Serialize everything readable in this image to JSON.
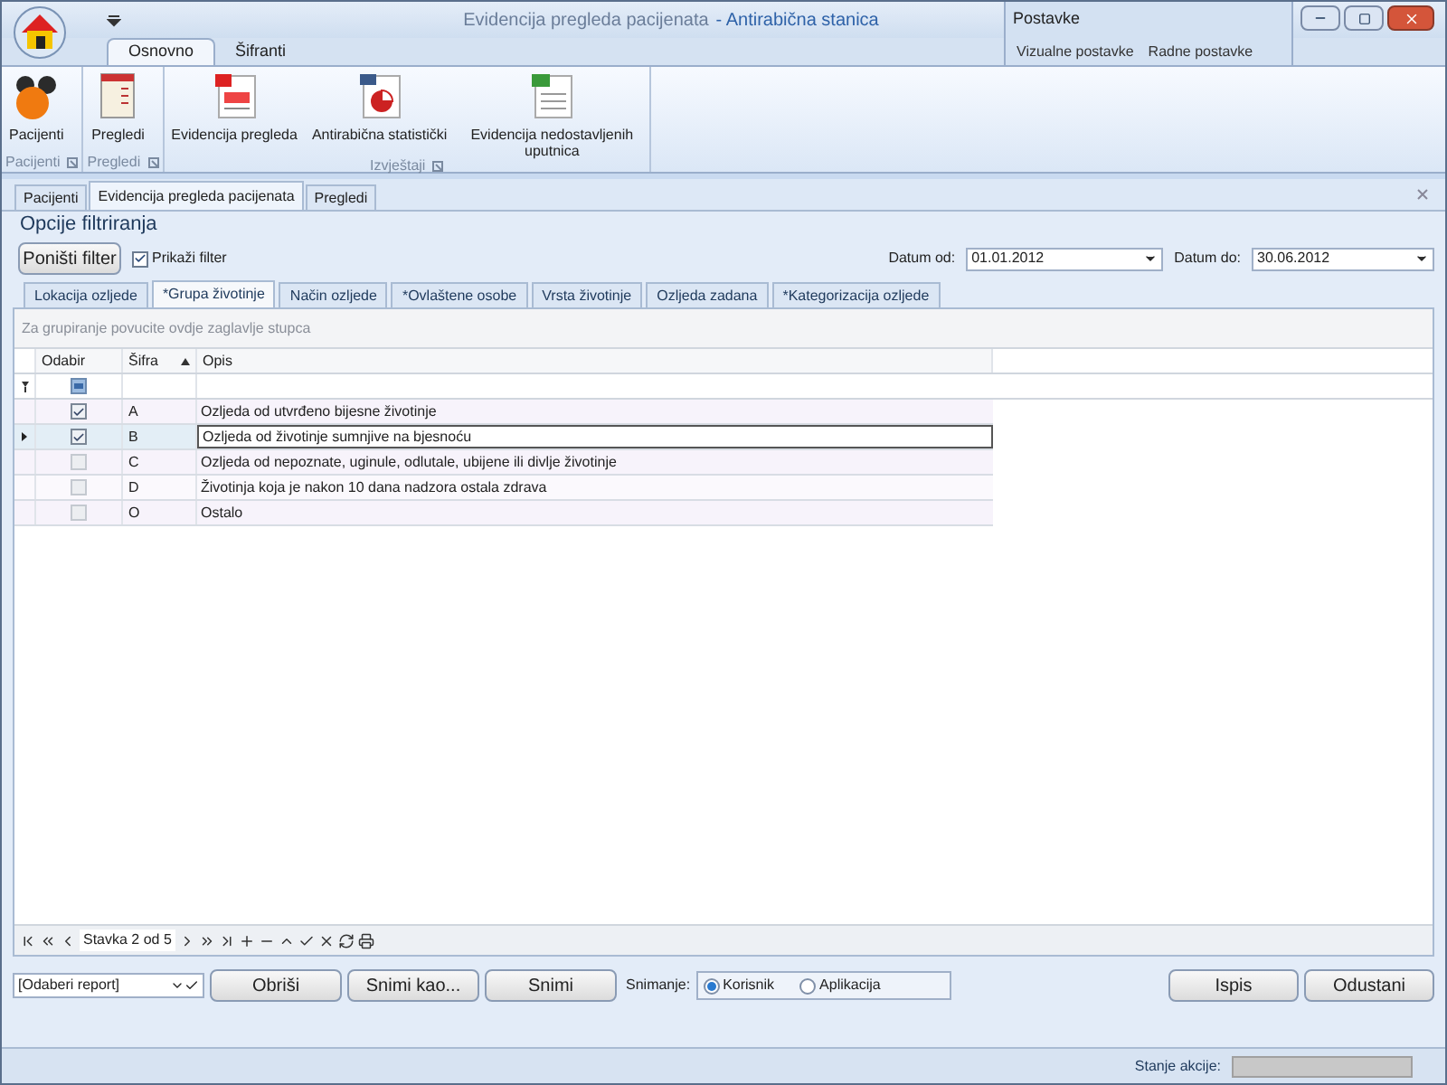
{
  "window": {
    "title": "Evidencija pregleda pacijenata",
    "subtitle": "- Antirabična stanica"
  },
  "context_group": {
    "title": "Postavke",
    "tabs": [
      {
        "label": "Vizualne postavke",
        "selected": false
      },
      {
        "label": "Radne postavke",
        "selected": false
      }
    ]
  },
  "ribbon_tabs": [
    {
      "label": "Osnovno",
      "selected": true
    },
    {
      "label": "Šifranti",
      "selected": false
    }
  ],
  "ribbon_groups": [
    {
      "title": "Pacijenti",
      "buttons": [
        {
          "label": "Pacijenti",
          "kind": "patients"
        }
      ]
    },
    {
      "title": "Pregledi",
      "buttons": [
        {
          "label": "Pregledi",
          "kind": "notebook"
        }
      ]
    },
    {
      "title": "Izvještaji",
      "buttons": [
        {
          "label": "Evidencija pregleda",
          "kind": "report"
        },
        {
          "label": "Antirabična statistički",
          "kind": "chart"
        },
        {
          "label": "Evidencija nedostavljenih uputnica",
          "kind": "sheet"
        }
      ]
    }
  ],
  "document_tabs": [
    {
      "label": "Pacijenti",
      "selected": false
    },
    {
      "label": "Evidencija pregleda pacijenata",
      "selected": true
    },
    {
      "label": "Pregledi",
      "selected": false
    }
  ],
  "filter_panel": {
    "title": "Opcije filtriranja",
    "reset_button": "Poništi filter",
    "show_filter": {
      "label": "Prikaži filter",
      "checked": true
    },
    "date_from": {
      "label": "Datum od:",
      "value": "01.01.2012"
    },
    "date_to": {
      "label": "Datum do:",
      "value": "30.06.2012"
    }
  },
  "category_tabs": [
    {
      "label": "Lokacija ozljede",
      "selected": false
    },
    {
      "label": "*Grupa životinje",
      "selected": true
    },
    {
      "label": "Način ozljede",
      "selected": false
    },
    {
      "label": "*Ovlaštene osobe",
      "selected": false
    },
    {
      "label": "Vrsta životinje",
      "selected": false
    },
    {
      "label": "Ozljeda zadana",
      "selected": false
    },
    {
      "label": "*Kategorizacija ozljede",
      "selected": false
    }
  ],
  "grid": {
    "group_panel_hint": "Za grupiranje povucite ovdje zaglavlje stupca",
    "columns": [
      {
        "label": "Odabir",
        "sorted_ascending": false
      },
      {
        "label": "Šifra",
        "sorted_ascending": true
      },
      {
        "label": "Opis",
        "sorted_ascending": false
      }
    ],
    "filter_row": {
      "indeterminate": true
    },
    "rows": [
      {
        "checked": true,
        "code": "A",
        "description": "Ozljeda od utvrđeno bijesne životinje",
        "selected": false
      },
      {
        "checked": true,
        "code": "B",
        "description": "Ozljeda od životinje sumnjive na bjesnoću",
        "selected": true
      },
      {
        "checked": false,
        "code": "C",
        "description": "Ozljeda od nepoznate, uginule, odlutale, ubijene ili divlje životinje",
        "selected": false
      },
      {
        "checked": false,
        "code": "D",
        "description": "Životinja koja je nakon 10 dana nadzora ostala zdrava",
        "selected": false
      },
      {
        "checked": false,
        "code": "O",
        "description": "Ostalo",
        "selected": false
      }
    ]
  },
  "navigator": {
    "position": "Stavka 2 od 5"
  },
  "footer": {
    "report_select": {
      "value": "[Odaberi report]"
    },
    "buttons": [
      "Obriši",
      "Snimi kao...",
      "Snimi"
    ],
    "save_mode": {
      "label": "Snimanje:",
      "options": [
        {
          "label": "Korisnik",
          "selected": true
        },
        {
          "label": "Aplikacija",
          "selected": false
        }
      ]
    },
    "action_buttons": [
      "Ispis",
      "Odustani"
    ]
  },
  "status_bar": {
    "label": "Stanje akcije:",
    "level": 0
  }
}
